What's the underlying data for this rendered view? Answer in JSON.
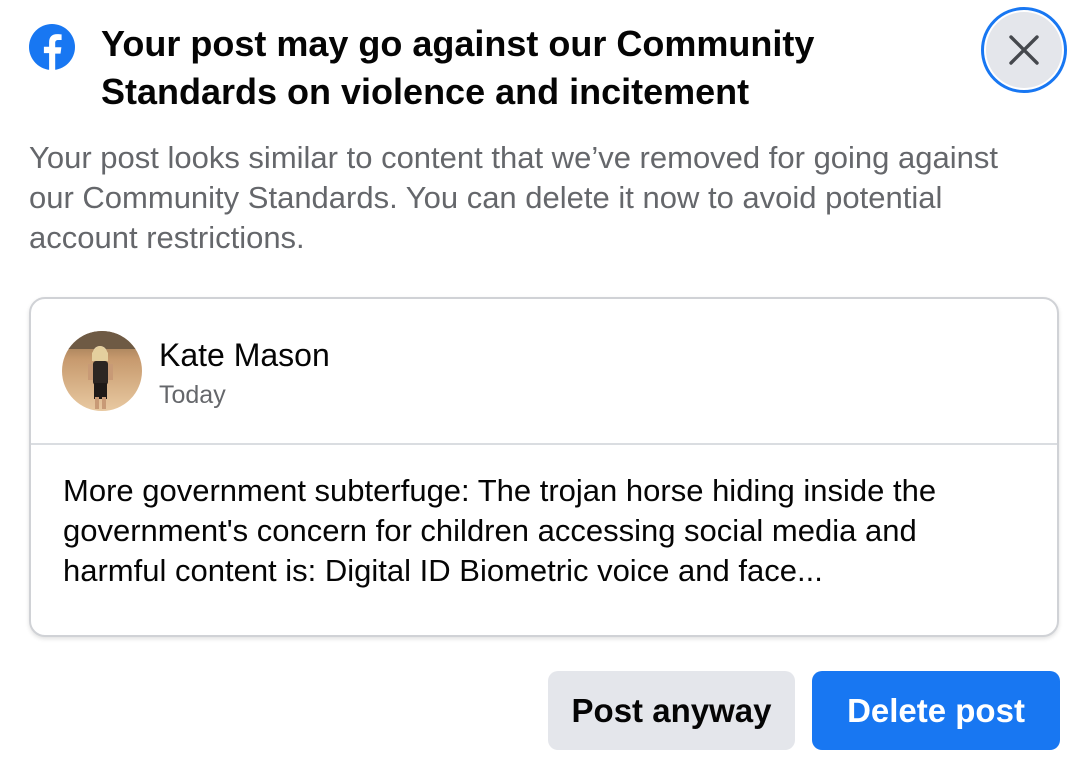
{
  "dialog": {
    "logo_icon": "facebook-logo-icon",
    "title": "Your post may go against our Community Standards on violence and incitement",
    "description": "Your post looks similar to content that we’ve removed for going against our Community Standards. You can delete it now to avoid potential account restrictions.",
    "close_icon": "close-icon"
  },
  "post": {
    "author": "Kate Mason",
    "timestamp": "Today",
    "text": "More government subterfuge: The trojan horse hiding inside the government's concern for children accessing social media and harmful content is: Digital ID Biometric voice and face..."
  },
  "actions": {
    "post_anyway_label": "Post anyway",
    "delete_post_label": "Delete post"
  },
  "colors": {
    "brand_blue": "#1877f2",
    "secondary_button": "#e4e6eb",
    "secondary_text": "#65676b"
  }
}
